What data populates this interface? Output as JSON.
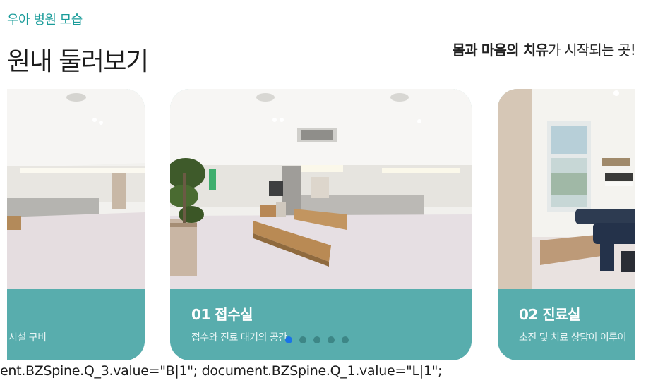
{
  "header": {
    "eyebrow": "우아 병원 모습",
    "title": "원내 둘러보기",
    "tagline_bold": "몸과 마음의 치유",
    "tagline_rest": "가 시작되는 곳!"
  },
  "carousel": {
    "slides": [
      {
        "title": "",
        "description": "시설 구비"
      },
      {
        "title": "01 접수실",
        "description": "접수와 진료 대기의 공간"
      },
      {
        "title": "02 진료실",
        "description": "초진 및 치료 상담이 이루어"
      }
    ],
    "dot_count": 5,
    "active_dot": 1
  },
  "code_line": "ent.BZSpine.Q_3.value=\"B|1\"; document.BZSpine.Q_1.value=\"L|1\";",
  "colors": {
    "accent": "#1a9c9a",
    "caption_bg": "#58adad",
    "active_dot": "#1a73e8",
    "inactive_dot": "#3d8686"
  }
}
